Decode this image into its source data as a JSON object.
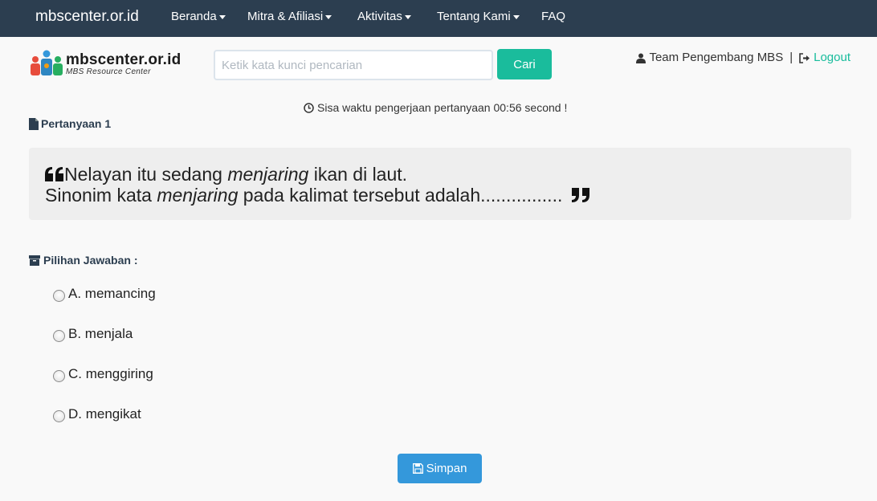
{
  "navbar": {
    "brand": "mbscenter.or.id",
    "items": [
      {
        "label": "Beranda",
        "dropdown": true
      },
      {
        "label": "Mitra & Afiliasi",
        "dropdown": true
      },
      {
        "label": "Aktivitas",
        "dropdown": true
      },
      {
        "label": "Tentang Kami",
        "dropdown": true
      },
      {
        "label": "FAQ",
        "dropdown": false
      }
    ]
  },
  "header": {
    "logo_title": "mbscenter.or.id",
    "logo_subtitle": "MBS Resource Center",
    "search_placeholder": "Ketik kata kunci pencarian",
    "search_button": "Cari",
    "user_name": "Team Pengembang MBS",
    "separator": "|",
    "logout_label": "Logout"
  },
  "timer": {
    "text": "Sisa waktu pengerjaan pertanyaan 00:56 second !"
  },
  "question": {
    "label": "Pertanyaan 1",
    "line1_pre": "Nelayan itu sedang ",
    "line1_em": "menjaring",
    "line1_post": " ikan di laut.",
    "line2_pre": "Sinonim kata ",
    "line2_em": "menjaring",
    "line2_post": " pada kalimat tersebut adalah................"
  },
  "answers": {
    "label": "Pilihan Jawaban :",
    "options": [
      {
        "text": "A. memancing"
      },
      {
        "text": "B. menjala"
      },
      {
        "text": "C. menggiring"
      },
      {
        "text": "D. mengikat"
      }
    ]
  },
  "save_button": "Simpan",
  "colors": {
    "navbar": "#2c3e50",
    "accent_teal": "#1abc9c",
    "save_blue": "#3498db",
    "quote_bg": "#eeeeee"
  }
}
